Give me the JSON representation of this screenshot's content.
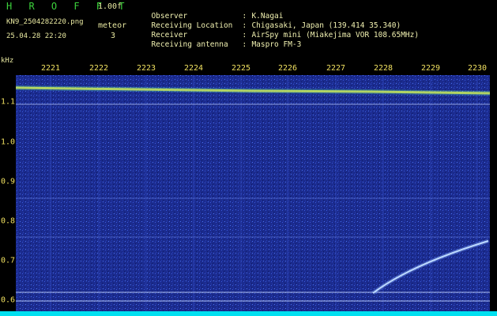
{
  "app": {
    "title": "H R O F F T",
    "version": "1.00f",
    "mode": "meteor",
    "count": "3"
  },
  "file": {
    "name": "KN9_2504282220.png",
    "datetime": "25.04.28 22:20"
  },
  "info": [
    {
      "key": "Observer",
      "value": "K.Nagai"
    },
    {
      "key": "Receiving Location",
      "value": "Chigasaki, Japan (139.414 35.340)"
    },
    {
      "key": "Receiver",
      "value": "AirSpy mini (Miakejima VOR 108.65MHz)"
    },
    {
      "key": "Receiving antenna",
      "value": "Maspro FM-3"
    }
  ],
  "axis": {
    "unit": "kHz",
    "x_ticks": [
      "2221",
      "2222",
      "2223",
      "2224",
      "2225",
      "2226",
      "2227",
      "2228",
      "2229",
      "2230"
    ],
    "y_ticks": [
      "1.1",
      "1.0",
      "0.9",
      "0.8",
      "0.7",
      "0.6"
    ]
  },
  "colors": {
    "background": "#1a2a8c",
    "carrier": "#e8e040",
    "meteor": "#d8f0ff",
    "strip": "#00e0f0"
  }
}
